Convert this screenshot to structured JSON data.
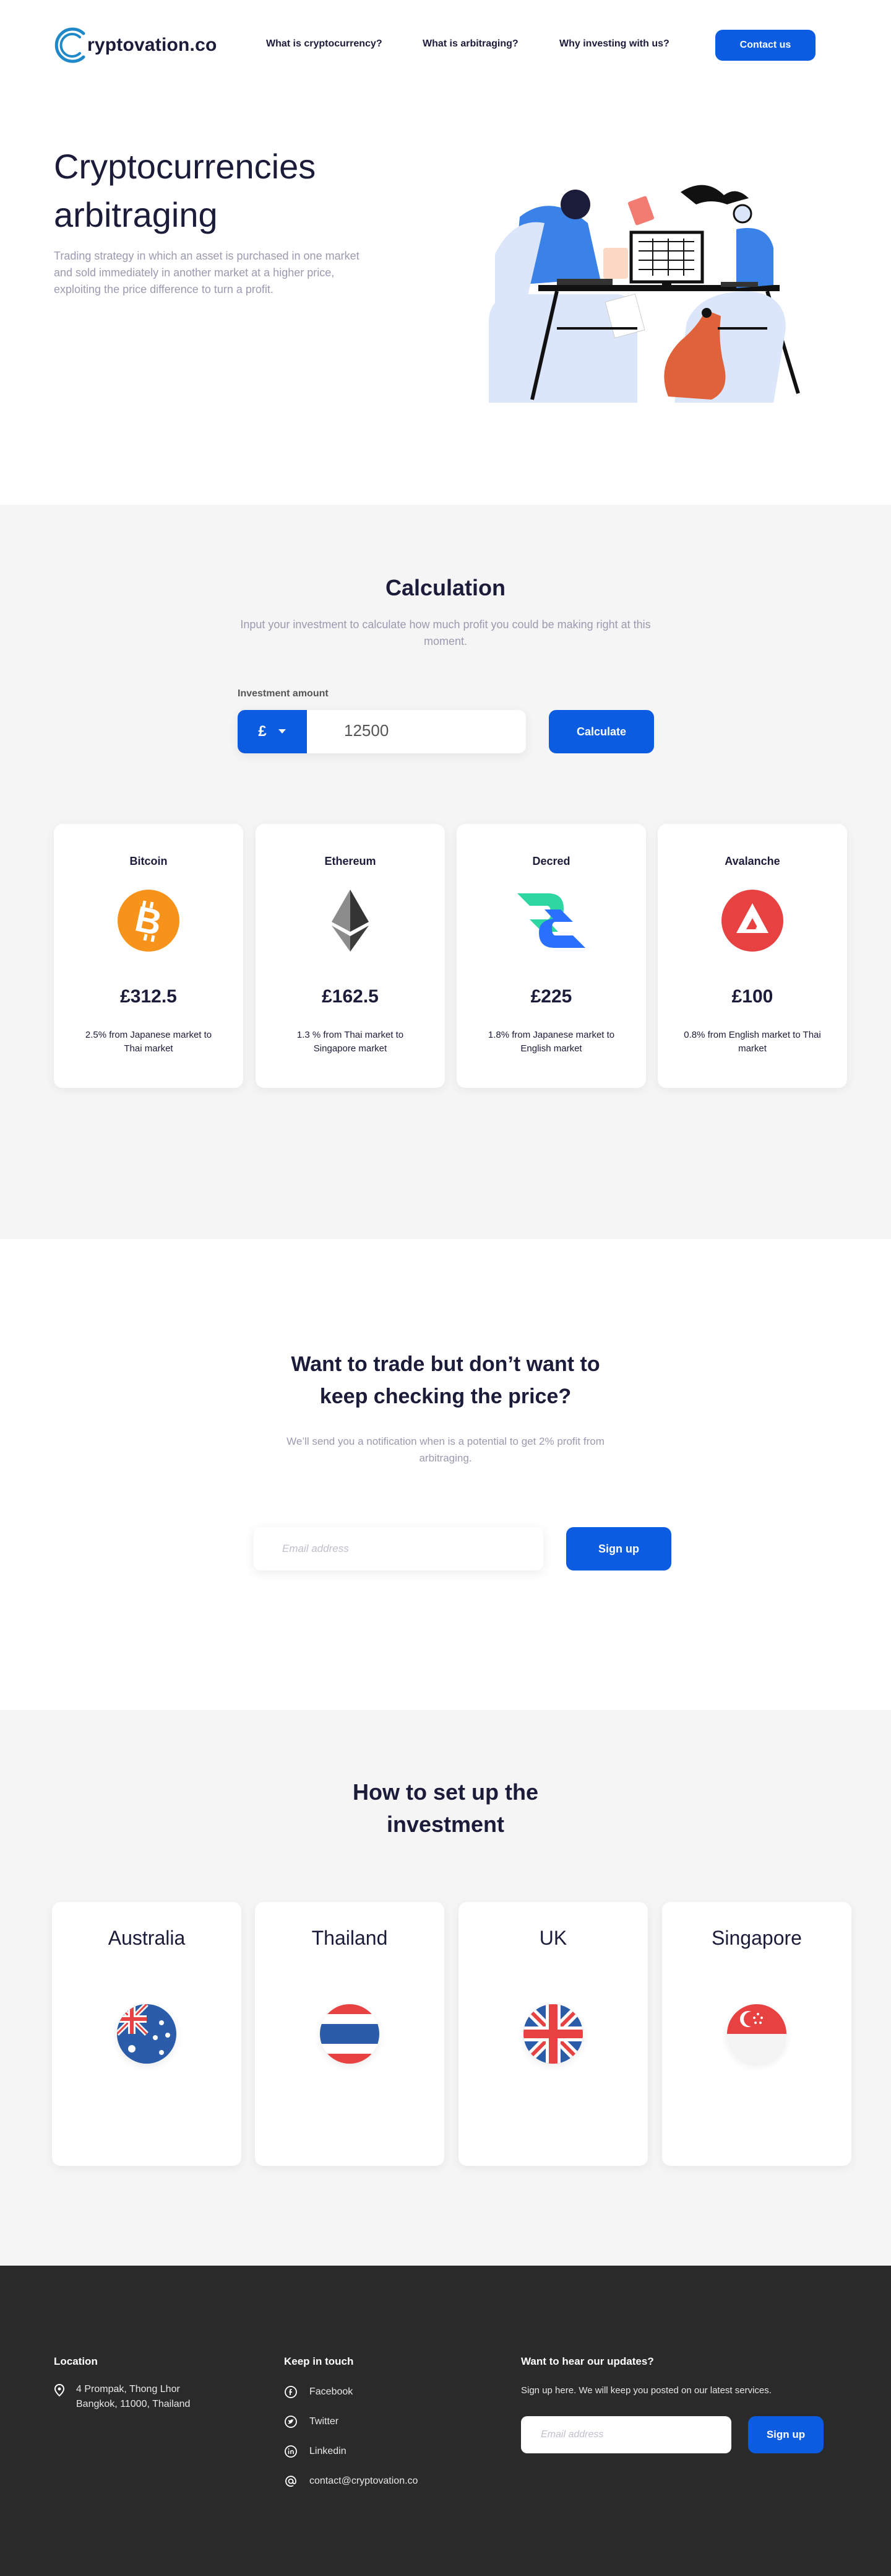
{
  "header": {
    "logo_letter": "C",
    "logo_text": "ryptovation.co",
    "nav": [
      "What is cryptocurrency?",
      "What is arbitraging?",
      "Why investing with us?"
    ],
    "contact_label": "Contact us"
  },
  "hero": {
    "title_line1": "Cryptocurrencies",
    "title_line2": "arbitraging",
    "subtitle": "Trading strategy in which an asset is purchased in one market and sold immediately in another market at a higher price, exploiting the price difference to turn a profit."
  },
  "calculation": {
    "title": "Calculation",
    "subtitle": "Input your investment to calculate how much profit you could be making right at this moment.",
    "input_label": "Investment amount",
    "currency": "£",
    "amount": "12500",
    "button_label": "Calculate",
    "cards": [
      {
        "name": "Bitcoin",
        "amount": "£312.5",
        "desc": "2.5% from Japanese market to Thai market",
        "icon": "bitcoin-icon",
        "color": "#f7931a"
      },
      {
        "name": "Ethereum",
        "amount": "£162.5",
        "desc": "1.3 % from Thai market to Singapore market",
        "icon": "ethereum-icon",
        "color": "#3c3c3d"
      },
      {
        "name": "Decred",
        "amount": "£225",
        "desc": "1.8% from Japanese market to English market",
        "icon": "decred-icon",
        "color": "#2970ff"
      },
      {
        "name": "Avalanche",
        "amount": "£100",
        "desc": "0.8% from English market to Thai market",
        "icon": "avalanche-icon",
        "color": "#e84142"
      }
    ]
  },
  "notify": {
    "title_line1": "Want to trade but don’t want to",
    "title_line2": "keep checking the price?",
    "subtitle": "We’ll send you a notification when is a potential to get 2% profit from arbitraging.",
    "email_placeholder": "Email address",
    "button_label": "Sign up"
  },
  "setup": {
    "title_line1": "How to set up the",
    "title_line2": "investment",
    "countries": [
      {
        "name": "Australia",
        "flag": "australia-flag-icon"
      },
      {
        "name": "Thailand",
        "flag": "thailand-flag-icon"
      },
      {
        "name": "UK",
        "flag": "uk-flag-icon"
      },
      {
        "name": "Singapore",
        "flag": "singapore-flag-icon"
      }
    ]
  },
  "footer": {
    "location_title": "Location",
    "address_line1": "4 Prompak, Thong Lhor",
    "address_line2": "Bangkok, 11000, Thailand",
    "keep_title": "Keep in touch",
    "links": [
      "Facebook",
      "Twitter",
      "Linkedin",
      "contact@cryptovation.co"
    ],
    "updates_title": "Want to hear our updates?",
    "updates_text": "Sign up here. We will keep you posted on our latest services.",
    "email_placeholder": "Email address",
    "button_label": "Sign up"
  },
  "colors": {
    "primary": "#0b5ce0",
    "dark_text": "#1b1b3a",
    "muted_text": "#9a9ab0",
    "section_bg": "#f5f5f5",
    "footer_bg": "#2a2a2a",
    "logo_teal": "#1e88c8"
  }
}
